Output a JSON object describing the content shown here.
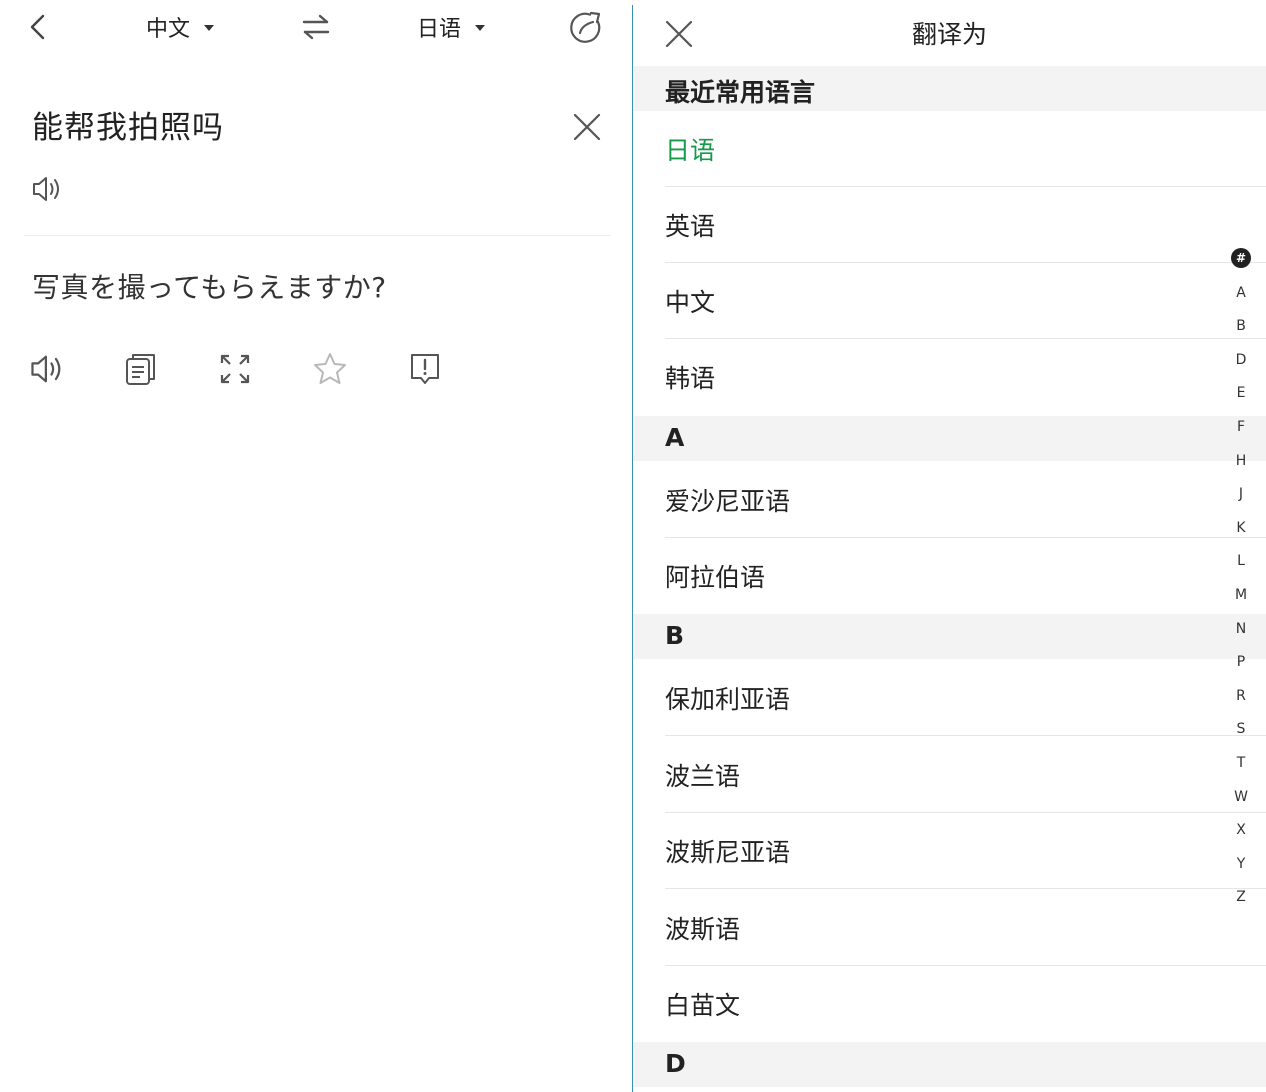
{
  "left": {
    "source_lang": "中文",
    "target_lang": "日语",
    "source_text": "能帮我拍照吗",
    "translated_text": "写真を撮ってもらえますか?",
    "icons": [
      "back-icon",
      "swap-icon",
      "history-icon",
      "clear-icon",
      "speaker-icon",
      "copy-icon",
      "fullscreen-icon",
      "star-icon",
      "report-icon"
    ]
  },
  "right": {
    "title": "翻译为",
    "sections": {
      "recent": "最近常用语言",
      "a": "A",
      "b": "B",
      "d": "D"
    },
    "recent_items": [
      "日语",
      "英语",
      "中文",
      "韩语"
    ],
    "a_items": [
      "爱沙尼亚语",
      "阿拉伯语"
    ],
    "b_items": [
      "保加利亚语",
      "波兰语",
      "波斯尼亚语",
      "波斯语",
      "白苗文"
    ],
    "selected_item": "日语",
    "index": [
      "#",
      "A",
      "B",
      "D",
      "E",
      "F",
      "H",
      "J",
      "K",
      "L",
      "M",
      "N",
      "P",
      "R",
      "S",
      "T",
      "W",
      "X",
      "Y",
      "Z"
    ]
  },
  "colors": {
    "selected": "#17994a",
    "section_bg": "#f3f3f3",
    "pane_divider": "#3a8fb4",
    "icon": "#555555"
  }
}
